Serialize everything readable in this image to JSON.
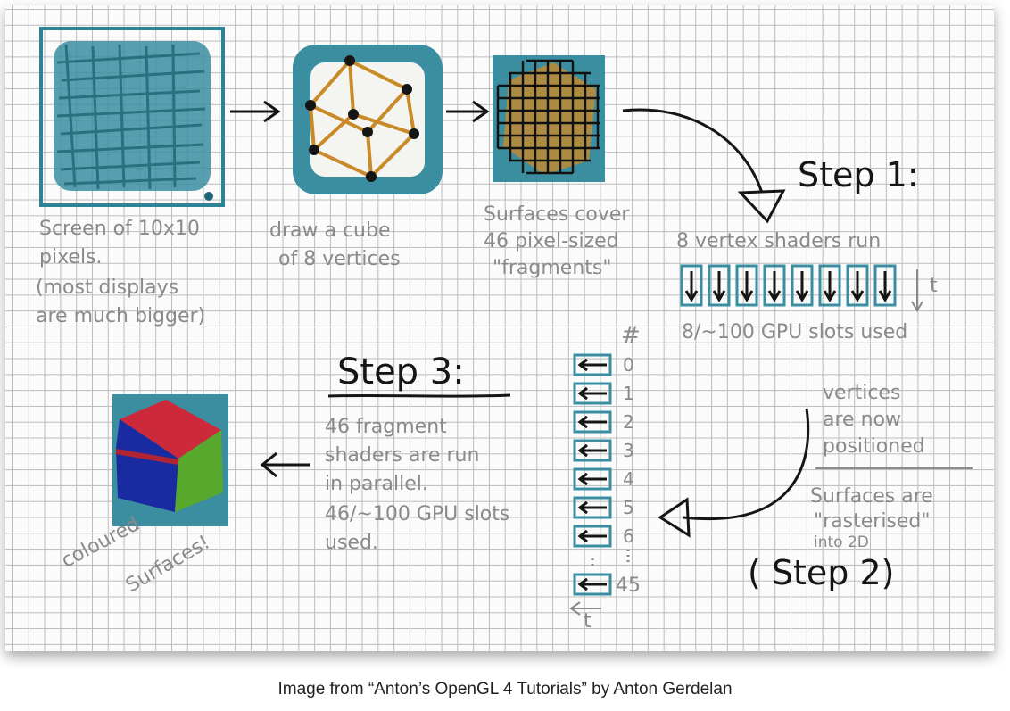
{
  "caption": "Image from “Anton’s OpenGL 4 Tutorials” by Anton Gerdelan",
  "panel1": {
    "line1": "Screen of 10x10",
    "line2": "pixels.",
    "line3": "(most displays",
    "line4": "are much bigger)"
  },
  "panel2": {
    "line1": "draw a cube",
    "line2": "of 8 vertices"
  },
  "panel3": {
    "line1": "Surfaces cover",
    "line2": "46 pixel-sized",
    "line3": "\"fragments\""
  },
  "step1": {
    "title": "Step 1:",
    "line1": "8 vertex shaders run",
    "time_label": "t",
    "usage": "8/~100 GPU slots used",
    "slot_count": 8
  },
  "step2": {
    "line1": "vertices",
    "line2": "are now",
    "line3": "positioned",
    "line4": "Surfaces are",
    "line5": "\"rasterised\"",
    "line6": "into 2D",
    "title": "( Step 2)"
  },
  "step3": {
    "title": "Step 3:",
    "line1": "46 fragment",
    "line2": "shaders are run",
    "line3": "in parallel.",
    "line4": "46/~100 GPU slots",
    "line5": "used."
  },
  "fragment_column": {
    "header": "#",
    "indices": [
      "0",
      "1",
      "2",
      "3",
      "4",
      "5",
      "6"
    ],
    "last_index": "45",
    "time_label": "t"
  },
  "result": {
    "line1": "coloured",
    "line2": "Surfaces!"
  },
  "colors": {
    "teal": "#3a8ea0",
    "orange": "#c98a2a",
    "red": "#cc2a3a",
    "blue": "#1a2aa0",
    "green": "#58a82e"
  }
}
